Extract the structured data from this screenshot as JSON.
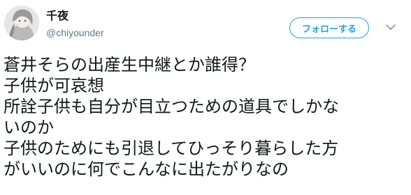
{
  "user": {
    "name": "千夜",
    "handle": "@chiyounder"
  },
  "follow_button": {
    "label": "フォローする"
  },
  "tweet": {
    "lines": [
      "蒼井そらの出産生中継とか誰得？",
      "子供が可哀想",
      "所詮子供も自分が目立つための道具でしかな",
      "いのか",
      "子供のためにも引退してひっそり暮らした方",
      "がいいのに何でこんなに出たがりなの"
    ]
  },
  "icons": {
    "avatar": "avatar",
    "menu": "chevron-down-icon"
  },
  "colors": {
    "accent": "#1da1f2",
    "text": "#14171a",
    "secondary_text": "#657786"
  }
}
